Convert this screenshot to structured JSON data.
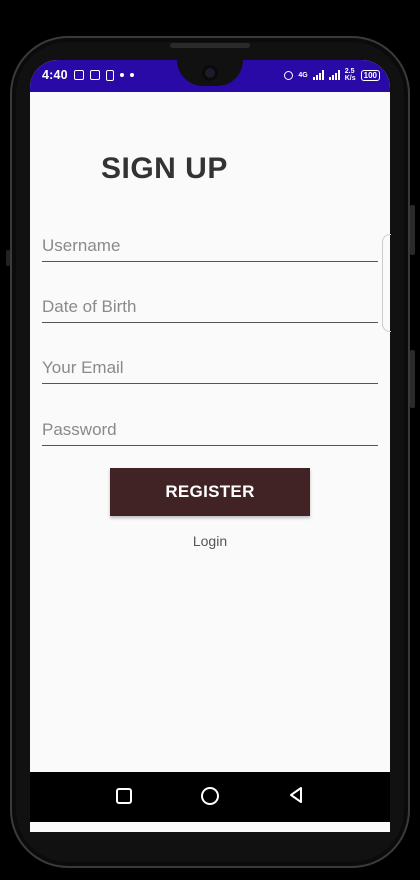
{
  "status_bar": {
    "time": "4:40",
    "network": "4G",
    "speed_value": "2.5",
    "speed_unit": "K/s",
    "battery": "100"
  },
  "form": {
    "title": "SIGN UP",
    "username_placeholder": "Username",
    "dob_placeholder": "Date of Birth",
    "email_placeholder": "Your Email",
    "password_placeholder": "Password",
    "register_label": "REGISTER",
    "login_label": "Login"
  },
  "colors": {
    "status_bar": "#2a0aa7",
    "register_button": "#412326",
    "screen_background": "#fafafa"
  }
}
